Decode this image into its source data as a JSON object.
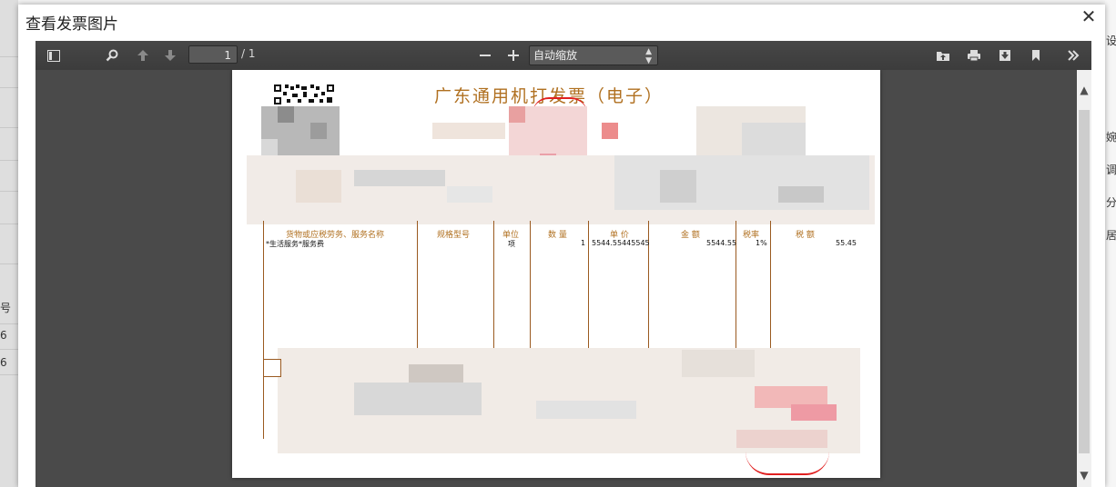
{
  "dialog": {
    "title": "查看发票图片",
    "close_label": "✕"
  },
  "toolbar": {
    "current_page": "1",
    "page_count": "/ 1",
    "zoom_value": "自动缩放",
    "icons": [
      "sidebar-toggle-icon",
      "search-icon",
      "previous-page-icon",
      "next-page-icon",
      "zoom-out-icon",
      "zoom-in-icon",
      "open-file-icon",
      "print-icon",
      "download-icon",
      "bookmark-icon",
      "tools-icon"
    ]
  },
  "invoice": {
    "title": "广东通用机打发票（电子）",
    "headers": {
      "item": "货物或应税劳务、服务名称",
      "spec": "规格型号",
      "unit": "单位",
      "qty": "数 量",
      "price": "单 价",
      "amount": "金 额",
      "tax_rate": "税率",
      "tax": "税 额"
    },
    "row": {
      "item": "*生活服务*服务费",
      "unit": "项",
      "qty": "1",
      "price": "5544.55445545",
      "amount": "5544.55",
      "tax_rate": "1%",
      "tax": "55.45"
    }
  },
  "background": {
    "left_labels": [
      "号",
      "6",
      "6"
    ],
    "right_labels": [
      "设",
      "婉",
      "调",
      "分",
      "居"
    ]
  },
  "colors": {
    "toolbar_bg": "#474747",
    "viewer_bg": "#4a4a4a",
    "invoice_text": "#b07020",
    "stamp": "#e02020"
  }
}
